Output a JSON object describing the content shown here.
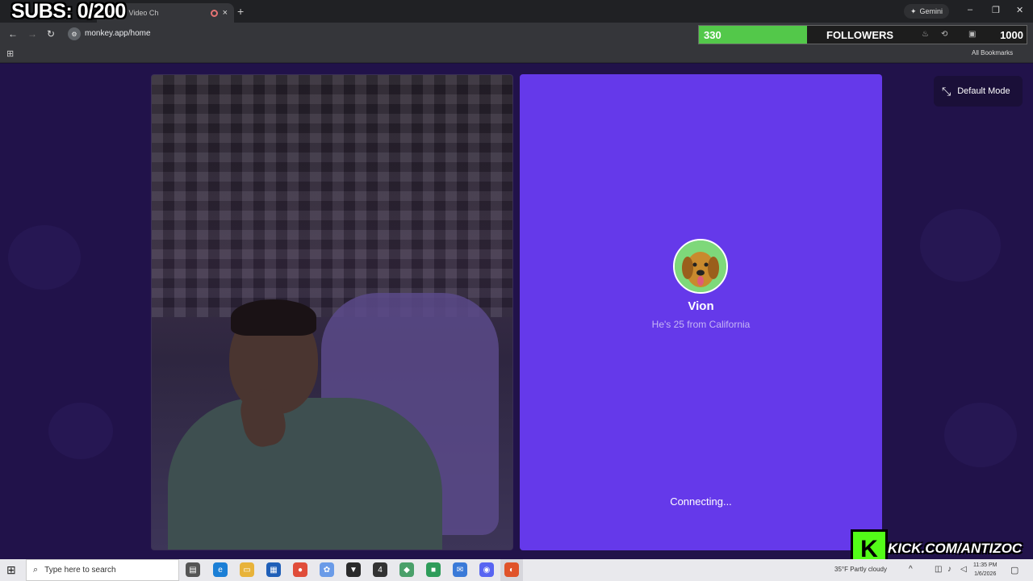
{
  "browser": {
    "tab_title": "ee Live Video Ch",
    "tab_close": "×",
    "new_tab": "+",
    "gemini_label": "Gemini",
    "url": "monkey.app/home",
    "all_bookmarks": "All Bookmarks",
    "window_controls": [
      "–",
      "❐",
      "✕"
    ]
  },
  "overlay": {
    "subs_text": "SUBS: 0/200",
    "followers_current": "330",
    "followers_label": "FOLLOWERS",
    "followers_goal": "1000",
    "followers_progress": 0.33,
    "kick_logo": "K",
    "kick_url": "KICK.COM/ANTIZOC"
  },
  "partner": {
    "name": "Vion",
    "info": "He's 25 from California",
    "status": "Connecting..."
  },
  "controls": {
    "mode_label": "Default Mode"
  },
  "taskbar": {
    "search_placeholder": "Type here to search",
    "weather": "35°F  Partly cloudy",
    "time": "11:35 PM",
    "date": "1/6/2026"
  },
  "colors": {
    "partner_bg": "#6539ea",
    "page_bg": "#21124a",
    "followers_fill": "#53c84a",
    "kick_green": "#53fc18"
  }
}
